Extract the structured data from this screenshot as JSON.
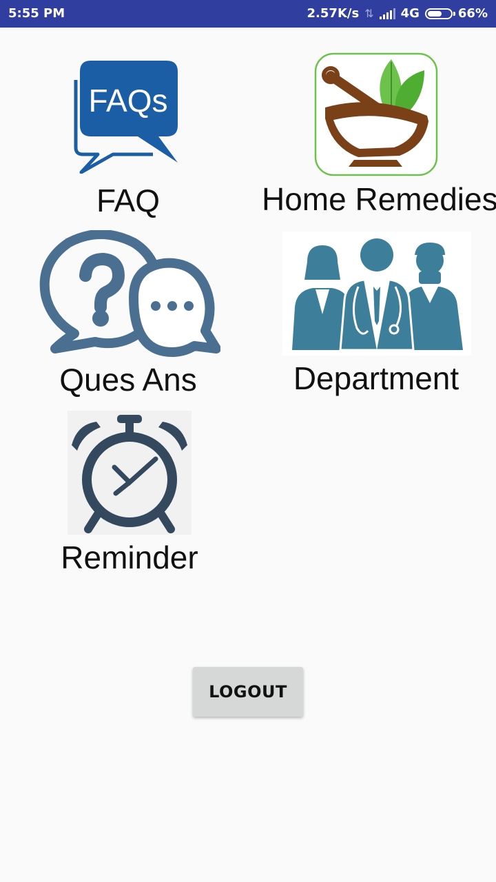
{
  "status_bar": {
    "time": "5:55 PM",
    "speed": "2.57K/s",
    "network": "4G",
    "battery": "66%",
    "battery_level": 0.66,
    "color": "#303f9f"
  },
  "menu": {
    "faq": {
      "label": "FAQ",
      "icon": "faq-speech-bubble-icon",
      "icon_text": "FAQs"
    },
    "home_remedies": {
      "label": "Home Remedies",
      "icon": "mortar-pestle-herb-icon"
    },
    "ques_ans": {
      "label": "Ques Ans",
      "icon": "question-chat-bubbles-icon"
    },
    "department": {
      "label": "Department",
      "icon": "medical-staff-icon"
    },
    "reminder": {
      "label": "Reminder",
      "icon": "alarm-clock-icon"
    }
  },
  "logout_label": "LOGOUT",
  "colors": {
    "faq_blue": "#1c5ea6",
    "qa_blue": "#4a6f91",
    "staff_teal": "#3d7f9a",
    "clock_dark": "#34495e",
    "remedy_green": "#6cc24a",
    "remedy_brown": "#7a4018"
  }
}
